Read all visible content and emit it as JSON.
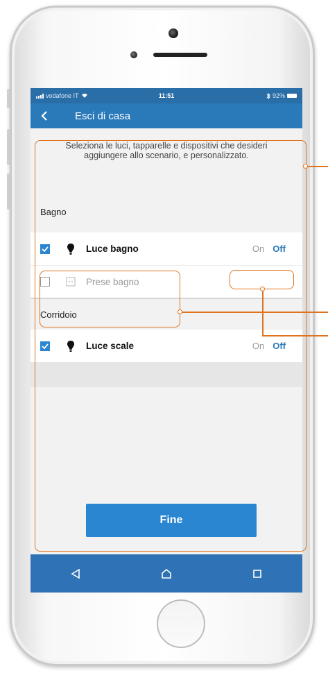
{
  "status_bar": {
    "carrier": "vodafone IT",
    "time": "11:51",
    "battery": "92%"
  },
  "header": {
    "title": "Esci di casa"
  },
  "intro_text": "Seleziona le luci, tapparelle e dispositivi che desideri aggiungere allo scenario, e personalizzato.",
  "sections": [
    {
      "title": "Bagno",
      "rows": [
        {
          "label": "Luce bagno",
          "checked": true,
          "icon": "bulb-icon",
          "toggle_on": "On",
          "toggle_off": "Off",
          "enabled": true
        },
        {
          "label": "Prese bagno",
          "checked": false,
          "icon": "socket-icon",
          "enabled": false
        }
      ]
    },
    {
      "title": "Corridoio",
      "rows": [
        {
          "label": "Luce scale",
          "checked": true,
          "icon": "bulb-icon",
          "toggle_on": "On",
          "toggle_off": "Off",
          "enabled": true
        }
      ]
    }
  ],
  "done_button": "Fine",
  "colors": {
    "primary": "#2a79b9",
    "accent_button": "#2a86d1",
    "annotation": "#e0731d"
  },
  "nav_icons": [
    "back-triangle-icon",
    "home-outline-icon",
    "recents-square-icon"
  ]
}
